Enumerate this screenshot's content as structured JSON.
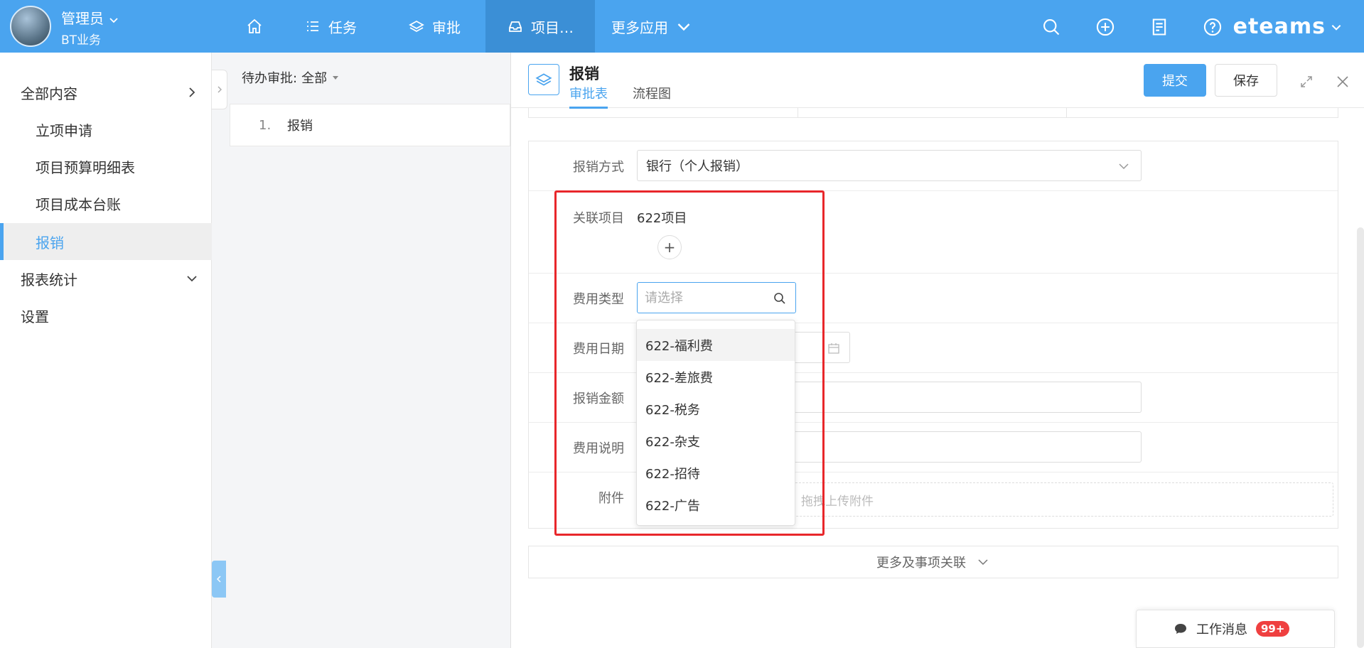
{
  "user": {
    "name": "管理员",
    "org": "BT业务"
  },
  "nav": {
    "items": [
      {
        "label": ""
      },
      {
        "label": "任务"
      },
      {
        "label": "审批"
      },
      {
        "label": "项目…"
      },
      {
        "label": "更多应用"
      }
    ]
  },
  "brand": "eteams",
  "sidebar": {
    "items": [
      {
        "label": "全部内容"
      },
      {
        "label": "立项申请"
      },
      {
        "label": "项目预算明细表"
      },
      {
        "label": "项目成本台账"
      },
      {
        "label": "报销"
      },
      {
        "label": "报表统计"
      },
      {
        "label": "设置"
      }
    ]
  },
  "list": {
    "filter_label": "待办审批:",
    "filter_value": "全部",
    "rows": [
      {
        "num": "1.",
        "title": "报销"
      }
    ]
  },
  "detail": {
    "title": "报销",
    "tabs": [
      {
        "label": "审批表"
      },
      {
        "label": "流程图"
      }
    ],
    "submit_label": "提交",
    "save_label": "保存"
  },
  "form": {
    "fields": {
      "method": {
        "label": "报销方式",
        "value": "银行（个人报销）"
      },
      "project": {
        "label": "关联项目",
        "value": "622项目"
      },
      "expense_type": {
        "label": "费用类型",
        "placeholder": "请选择"
      },
      "expense_date": {
        "label": "费用日期"
      },
      "amount": {
        "label": "报销金额"
      },
      "description": {
        "label": "费用说明"
      },
      "attachment": {
        "label": "附件",
        "hint": "拖拽上传附件"
      }
    },
    "dropdown_options": [
      "622-福利费",
      "622-差旅费",
      "622-税务",
      "622-杂支",
      "622-招待",
      "622-广告"
    ],
    "more_label": "更多及事项关联"
  },
  "messages": {
    "label": "工作消息",
    "badge": "99+"
  },
  "colors": {
    "primary": "#4aa4ef",
    "highlight": "#e8272b",
    "badge": "#ef4040"
  }
}
